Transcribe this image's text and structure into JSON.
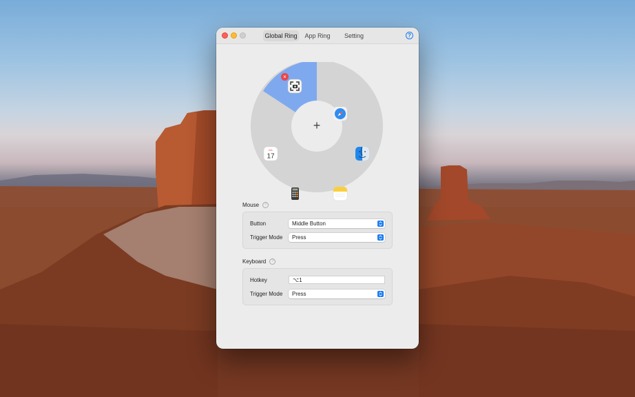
{
  "window": {
    "tabs": [
      {
        "label": "Global Ring",
        "active": true
      },
      {
        "label": "App Ring",
        "active": false
      },
      {
        "label": "Setting",
        "active": false
      }
    ],
    "help_icon": "?"
  },
  "ring": {
    "center_icon": "+",
    "apps": [
      {
        "name": "screenshot-icon",
        "selected": true
      },
      {
        "name": "safari-icon"
      },
      {
        "name": "finder-icon"
      },
      {
        "name": "notes-icon"
      },
      {
        "name": "calculator-icon"
      },
      {
        "name": "calendar-icon",
        "calendar_month": "JUL",
        "calendar_day": "17"
      }
    ],
    "selected_color": "#7ea9ef",
    "ring_color": "#d4d4d4"
  },
  "mouse": {
    "label": "Mouse",
    "button_label": "Button",
    "button_value": "Middle Button",
    "trigger_label": "Trigger Mode",
    "trigger_value": "Press"
  },
  "keyboard": {
    "label": "Keyboard",
    "hotkey_label": "Hotkey",
    "hotkey_value": "⌥1",
    "trigger_label": "Trigger Mode",
    "trigger_value": "Press"
  },
  "colors": {
    "accent": "#1a7cf2",
    "close": "#fe5f57",
    "minimize": "#febc2e",
    "zoom_disabled": "#cfcfcf"
  }
}
